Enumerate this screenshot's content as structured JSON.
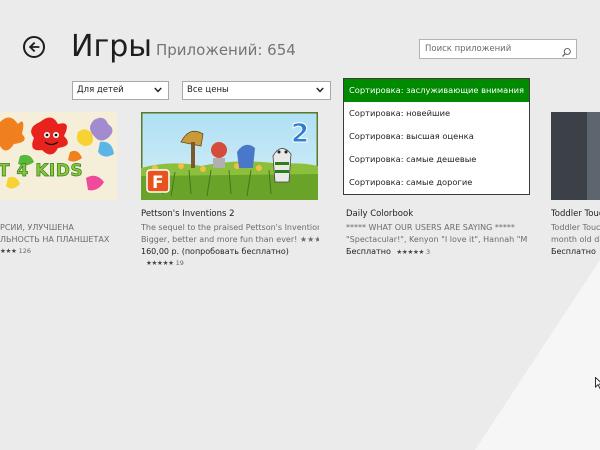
{
  "header": {
    "title": "Игры",
    "app_count": "Приложений: 654"
  },
  "search": {
    "placeholder": "Поиск приложений"
  },
  "filters": {
    "audience": "Для детей",
    "price": "Все цены"
  },
  "sort_menu": {
    "options": [
      "Сортировка: заслуживающие внимания",
      "Сортировка: новейшие",
      "Сортировка: высшая оценка",
      "Сортировка: самые дешевые",
      "Сортировка: самые дорогие"
    ],
    "selected_index": 0
  },
  "apps": [
    {
      "tile_text": "T 4 KIDS",
      "title": "",
      "desc_line1": "РСИИ, УЛУЧШЕНА",
      "desc_line2": "ЛЬНОСТЬ НА ПЛАНШЕТАХ",
      "price": "",
      "stars": "★★★",
      "rating_count": "126"
    },
    {
      "tile_badge": "2",
      "tile_logo": "F",
      "title": "Pettson's Inventions 2",
      "desc_line1": "The sequel to the praised Pettson's Inventions.",
      "desc_line2": "Bigger, better and more fun than ever! ★★★",
      "price": "160,00 р. (попробовать бесплатно)",
      "stars": "★★★★★",
      "rating_count": "19"
    },
    {
      "title": "Daily Colorbook",
      "desc_line1": "***** WHAT OUR USERS ARE SAYING *****",
      "desc_line2": "\"Spectacular!\", Kenyon \"I love it\", Hannah \"My",
      "price": "Бесплатно",
      "stars": "★★★★★",
      "rating_count": "3"
    },
    {
      "title": "Toddler Touc",
      "desc_line1": "Toddler Touc",
      "desc_line2": "month old da",
      "price": "Бесплатно",
      "stars": "★★★★★",
      "rating_count": ""
    }
  ],
  "colors": {
    "accent": "#008a00",
    "background": "#ebebeb",
    "tile4": "#3c4147"
  }
}
